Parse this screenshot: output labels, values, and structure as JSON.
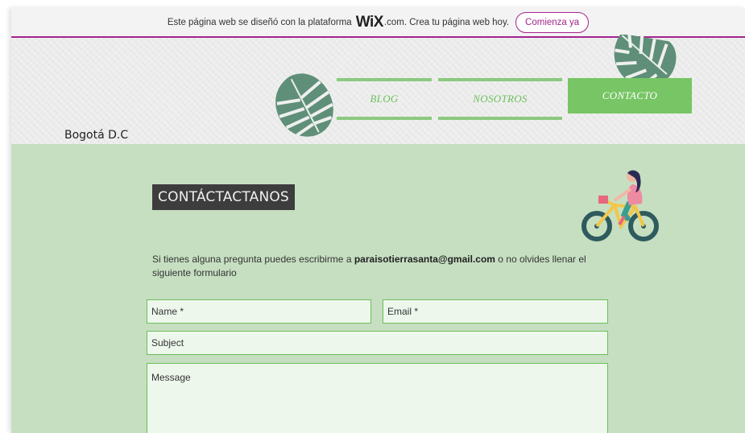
{
  "wix_banner": {
    "text_before": "Este página web se diseñó con la plataforma",
    "logo": "WiX",
    "text_after": ".com. Crea tu página web hoy.",
    "button_label": "Comienza ya",
    "accent_color": "#a4248e"
  },
  "header": {
    "location": "Bogotá D.C",
    "nav": [
      {
        "label": "BLOG",
        "active": false
      },
      {
        "label": "NOSOTROS",
        "active": false
      },
      {
        "label": "CONTACTO",
        "active": true
      }
    ],
    "nav_color": "#77c564",
    "decor_icons": [
      "monstera-leaf-icon",
      "monstera-leaf-icon"
    ]
  },
  "contact": {
    "title": "CONTÁCTACTANOS",
    "intro_before": "Si tienes alguna pregunta puedes escribirme a",
    "email": "paraisotierrasanta@gmail.com",
    "intro_after": "o no olvides llenar el siguiente formulario",
    "illustration": "woman-on-bicycle-icon",
    "background_color": "#c6dfc1"
  },
  "form": {
    "name_placeholder": "Name *",
    "email_placeholder": "Email *",
    "subject_placeholder": "Subject",
    "message_placeholder": "Message"
  }
}
